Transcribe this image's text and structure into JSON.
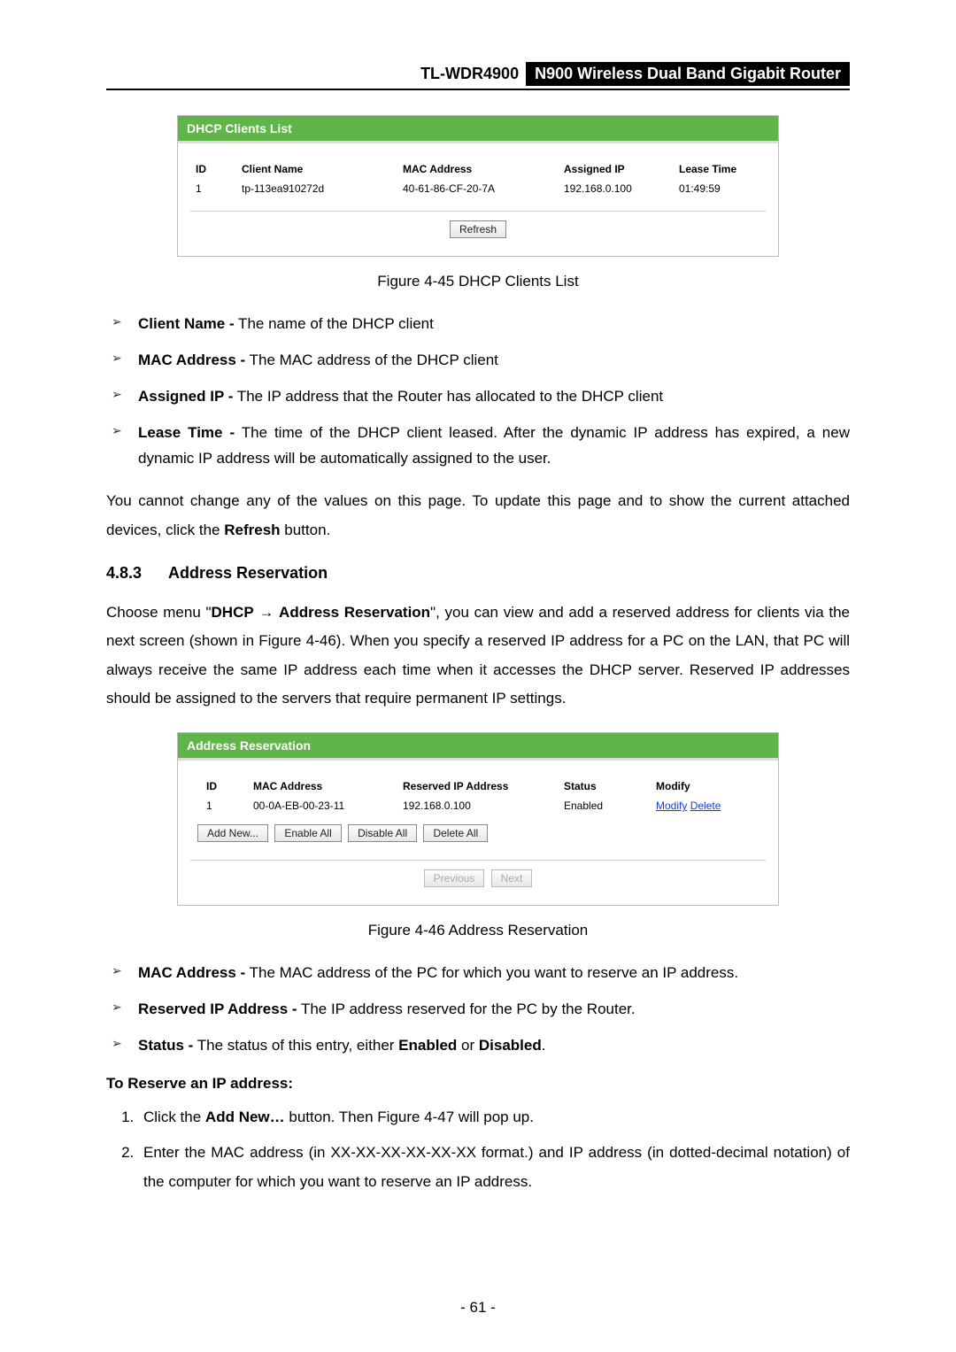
{
  "header": {
    "model": "TL-WDR4900",
    "product": "N900 Wireless Dual Band Gigabit Router"
  },
  "fig45": {
    "panel_title": "DHCP Clients List",
    "cols": {
      "id": "ID",
      "name": "Client Name",
      "mac": "MAC Address",
      "ip": "Assigned IP",
      "lease": "Lease Time"
    },
    "row": {
      "id": "1",
      "name": "tp-113ea910272d",
      "mac": "40-61-86-CF-20-7A",
      "ip": "192.168.0.100",
      "lease": "01:49:59"
    },
    "refresh": "Refresh",
    "caption": "Figure 4-45 DHCP Clients List"
  },
  "list1": {
    "i1_b": "Client Name -",
    "i1_t": " The name of the DHCP client",
    "i2_b": "MAC Address -",
    "i2_t": " The MAC address of the DHCP client",
    "i3_b": "Assigned IP -",
    "i3_t": " The IP address that the Router has allocated to the DHCP client",
    "i4_b": "Lease Time -",
    "i4_t": " The time of the DHCP client leased. After the dynamic IP address has expired, a new dynamic IP address will be automatically assigned to the user."
  },
  "para1_a": "You cannot change any of the values on this page. To update this page and to show the current attached devices, click the ",
  "para1_b": "Refresh",
  "para1_c": " button.",
  "section": {
    "num": "4.8.3",
    "title": "Address Reservation"
  },
  "para2_a": "Choose menu \"",
  "para2_b": "DHCP",
  "para2_arrow": " → ",
  "para2_c": "Address Reservation",
  "para2_d": "\", you can view and add a reserved address for clients via the next screen (shown in Figure 4-46). When you specify a reserved IP address for a PC on the LAN, that PC will always receive the same IP address each time when it accesses the DHCP server. Reserved IP addresses should be assigned to the servers that require permanent IP settings.",
  "fig46": {
    "panel_title": "Address Reservation",
    "cols": {
      "id": "ID",
      "mac": "MAC Address",
      "ip": "Reserved IP Address",
      "status": "Status",
      "modify": "Modify"
    },
    "row": {
      "id": "1",
      "mac": "00-0A-EB-00-23-11",
      "ip": "192.168.0.100",
      "status": "Enabled",
      "modify": "Modify",
      "delete": "Delete"
    },
    "btns": {
      "add": "Add New...",
      "en": "Enable All",
      "dis": "Disable All",
      "del": "Delete All",
      "prev": "Previous",
      "next": "Next"
    },
    "caption": "Figure 4-46 Address Reservation"
  },
  "list2": {
    "i1_b": "MAC Address -",
    "i1_t": " The MAC address of the PC for which you want to reserve an IP address.",
    "i2_b": "Reserved IP Address -",
    "i2_t": " The IP address reserved for the PC by the Router.",
    "i3_b": "Status -",
    "i3_a": " The status of this entry, either ",
    "i3_b2": "Enabled",
    "i3_c": " or ",
    "i3_b3": "Disabled",
    "i3_d": "."
  },
  "reserve_title": "To Reserve an IP address:",
  "steps": {
    "s1_a": "Click the ",
    "s1_b": "Add New…",
    "s1_c": " button. Then Figure 4-47 will pop up.",
    "s2": "Enter the MAC address (in XX-XX-XX-XX-XX-XX format.) and IP address (in dotted-decimal notation) of the computer for which you want to reserve an IP address."
  },
  "pagenum": "- 61 -"
}
